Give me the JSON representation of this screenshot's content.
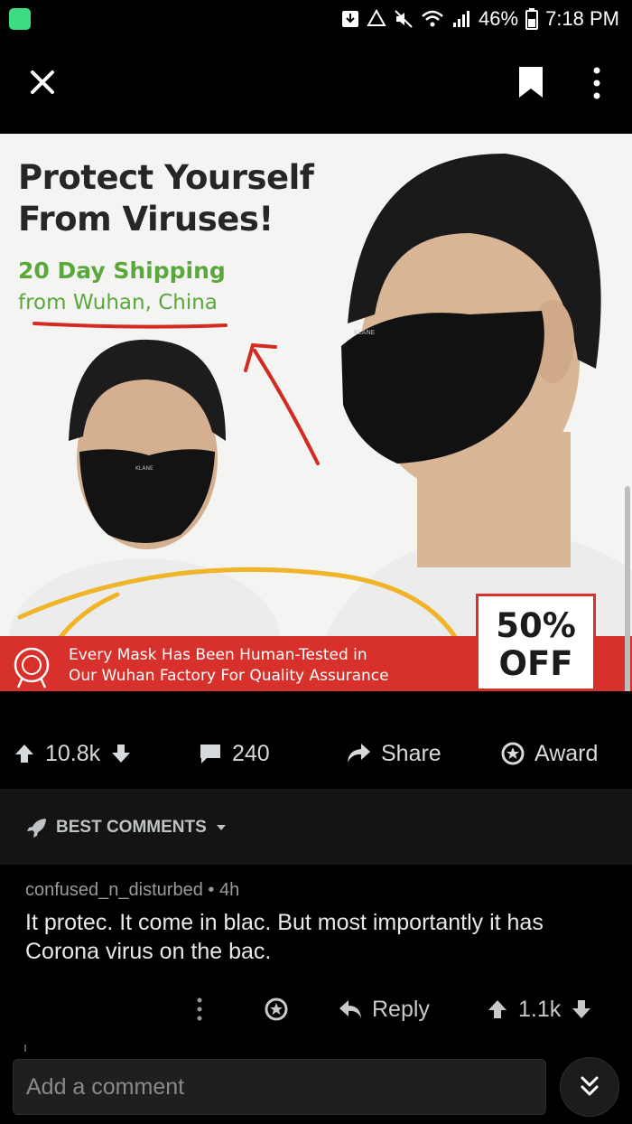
{
  "status_bar": {
    "battery": "46%",
    "time": "7:18 PM"
  },
  "post_image": {
    "headline": "Protect Yourself From Viruses!",
    "shipping": "20 Day Shipping",
    "origin": "from Wuhan, China",
    "banner": "Every Mask Has Been Human-Tested in\nOur Wuhan Factory For Quality Assurance",
    "discount": "50% OFF",
    "mask_brand": "KLANE"
  },
  "actions": {
    "upvotes": "10.8k",
    "comments": "240",
    "share_label": "Share",
    "award_label": "Award"
  },
  "sort": {
    "label": "BEST COMMENTS"
  },
  "comment": {
    "author": "confused_n_disturbed",
    "age": "4h",
    "body": "It protec. It come in blac. But most importantly it has Corona virus on the bac.",
    "reply_label": "Reply",
    "score": "1.1k"
  },
  "comment_input": {
    "placeholder": "Add a comment"
  },
  "colors": {
    "background": "#000000",
    "banner_red": "#d8302a",
    "shipping_green": "#5aa83c",
    "android_badge": "#3ddc84"
  }
}
